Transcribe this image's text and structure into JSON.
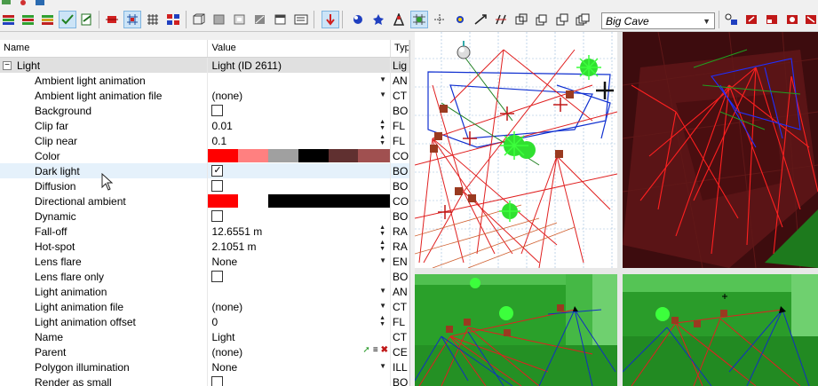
{
  "toolbar": {
    "view_select": "Big Cave"
  },
  "grid": {
    "header": {
      "name": "Name",
      "value": "Value",
      "type": "Typ"
    },
    "group": {
      "name": "Light",
      "value": "Light (ID 2611)",
      "type": "Lig"
    },
    "rows": [
      {
        "name": "Ambient light animation",
        "value": "",
        "type": "AN",
        "kind": "dropdown"
      },
      {
        "name": "Ambient light animation file",
        "value": "(none)",
        "type": "CT",
        "kind": "dropdown"
      },
      {
        "name": "Background",
        "value": "",
        "type": "BO",
        "kind": "checkbox",
        "checked": false
      },
      {
        "name": "Clip far",
        "value": "0.01",
        "type": "FL",
        "kind": "spin"
      },
      {
        "name": "Clip near",
        "value": "0.1",
        "type": "FL",
        "kind": "spin"
      },
      {
        "name": "Color",
        "value": "",
        "type": "CO",
        "kind": "color"
      },
      {
        "name": "Dark light",
        "value": "",
        "type": "BO",
        "kind": "checkbox",
        "checked": true
      },
      {
        "name": "Diffusion",
        "value": "",
        "type": "BO",
        "kind": "checkbox",
        "checked": false
      },
      {
        "name": "Directional ambient",
        "value": "",
        "type": "CO",
        "kind": "color2"
      },
      {
        "name": "Dynamic",
        "value": "",
        "type": "BO",
        "kind": "checkbox",
        "checked": false
      },
      {
        "name": "Fall-off",
        "value": "12.6551 m",
        "type": "RA",
        "kind": "spin"
      },
      {
        "name": "Hot-spot",
        "value": "2.1051 m",
        "type": "RA",
        "kind": "spin"
      },
      {
        "name": "Lens flare",
        "value": "None",
        "type": "EN",
        "kind": "dropdown"
      },
      {
        "name": "Lens flare only",
        "value": "",
        "type": "BO",
        "kind": "checkbox",
        "checked": false
      },
      {
        "name": "Light animation",
        "value": "",
        "type": "AN",
        "kind": "dropdown"
      },
      {
        "name": "Light animation file",
        "value": "(none)",
        "type": "CT",
        "kind": "dropdown"
      },
      {
        "name": "Light animation offset",
        "value": "0",
        "type": "FL",
        "kind": "spin"
      },
      {
        "name": "Name",
        "value": "Light",
        "type": "CT",
        "kind": "text"
      },
      {
        "name": "Parent",
        "value": "(none)",
        "type": "CE",
        "kind": "parent"
      },
      {
        "name": "Polygon illumination",
        "value": "None",
        "type": "ILL",
        "kind": "dropdown"
      },
      {
        "name": "Render as small",
        "value": "",
        "type": "BO",
        "kind": "checkbox",
        "checked": false
      }
    ],
    "checkmark": "✓",
    "color_swatches": [
      "#ff0000",
      "#ff8080",
      "#a0a0a0",
      "#000000",
      "#603030",
      "#a05050"
    ],
    "directional_swatches": [
      "#ff0000",
      "#ffffff",
      "#000000"
    ]
  },
  "colors": {
    "accent_select": "#cce4f7",
    "group_row": "#e0e0e0",
    "hover_row": "#e5f1fb"
  }
}
